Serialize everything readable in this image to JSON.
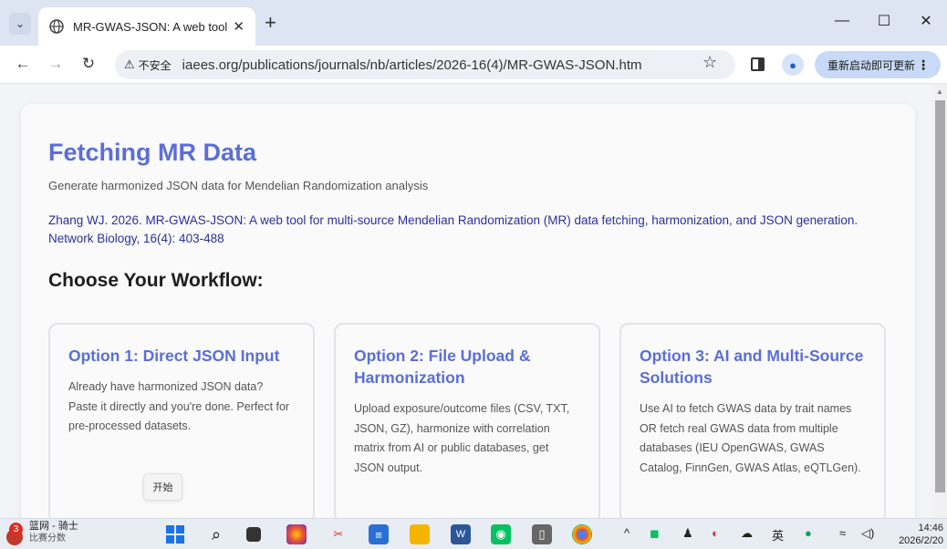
{
  "browser": {
    "tab_title": "MR-GWAS-JSON: A web tool for multi-source Mendelian Randomization",
    "security_label": "不安全",
    "url": "iaees.org/publications/journals/nb/articles/2026-16(4)/MR-GWAS-JSON.htm",
    "update_label": "重新启动即可更新"
  },
  "page": {
    "title": "Fetching MR Data",
    "subtitle": "Generate harmonized JSON data for Mendelian Randomization analysis",
    "citation": "Zhang WJ. 2026. MR-GWAS-JSON: A web tool for multi-source Mendelian Randomization (MR) data fetching, harmonization, and JSON generation. Network Biology, 16(4): 403-488",
    "workflow_heading": "Choose Your Workflow:",
    "options": [
      {
        "title": "Option 1: Direct JSON Input",
        "desc": "Already have harmonized JSON data? Paste it directly and you're done. Perfect for pre-processed datasets."
      },
      {
        "title": "Option 2: File Upload & Harmonization",
        "desc": "Upload exposure/outcome files (CSV, TXT, JSON, GZ), harmonize with correlation matrix from AI or public databases, get JSON output."
      },
      {
        "title": "Option 3: AI and Multi-Source Solutions",
        "desc": "Use AI to fetch GWAS data by trait names OR fetch real GWAS data from multiple databases (IEU OpenGWAS, GWAS Catalog, FinnGen, GWAS Atlas, eQTLGen)."
      }
    ],
    "tooltip_label": "开始"
  },
  "taskbar": {
    "widget_badge": "3",
    "widget_title": "篮网 - 骑士",
    "widget_sub": "比赛分数",
    "ime_label": "英",
    "time": "14:46",
    "date": "2026/2/20"
  },
  "colors": {
    "accent": "#5b6ed6",
    "citation": "#2a3296"
  }
}
